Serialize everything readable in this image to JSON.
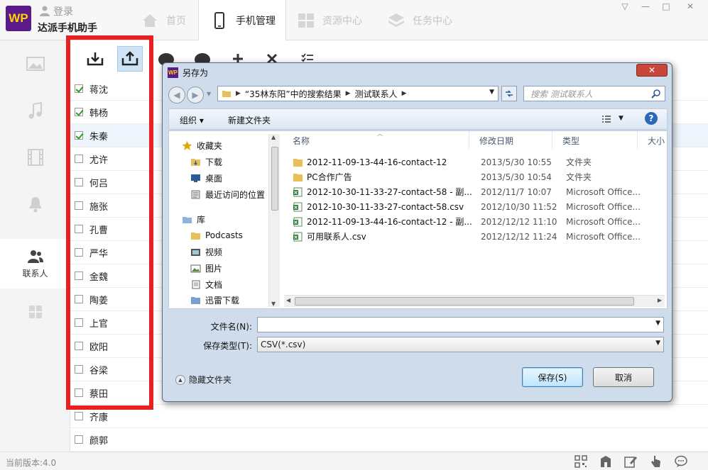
{
  "app": {
    "logo_text": "WP",
    "login_label": "登录",
    "title": "达派手机助手",
    "tabs": [
      {
        "label": "首页",
        "icon": "home-icon"
      },
      {
        "label": "手机管理",
        "icon": "phone-icon"
      },
      {
        "label": "资源中心",
        "icon": "grid-icon"
      },
      {
        "label": "任务中心",
        "icon": "layers-icon"
      }
    ],
    "window_controls": [
      "▽",
      "—",
      "□",
      "✕"
    ]
  },
  "left_nav": {
    "items": [
      {
        "icon": "photo-icon",
        "label": ""
      },
      {
        "icon": "music-icon",
        "label": ""
      },
      {
        "icon": "video-icon",
        "label": ""
      },
      {
        "icon": "bell-icon",
        "label": ""
      },
      {
        "icon": "contacts-icon",
        "label": "联系人"
      },
      {
        "icon": "apps-icon",
        "label": ""
      }
    ]
  },
  "toolbar": {
    "icons": [
      "import-icon",
      "export-icon",
      "download-icon",
      "upload-icon",
      "add-icon",
      "delete-icon",
      "check-list-icon"
    ]
  },
  "contacts": [
    {
      "name": "蒋沈",
      "checked": true
    },
    {
      "name": "韩杨",
      "checked": true
    },
    {
      "name": "朱秦",
      "checked": true
    },
    {
      "name": "尤许",
      "checked": false
    },
    {
      "name": "何吕",
      "checked": false
    },
    {
      "name": "施张",
      "checked": false
    },
    {
      "name": "孔曹",
      "checked": false
    },
    {
      "name": "严华",
      "checked": false
    },
    {
      "name": "金魏",
      "checked": false
    },
    {
      "name": "陶姜",
      "checked": false
    },
    {
      "name": "上官",
      "checked": false
    },
    {
      "name": "欧阳",
      "checked": false
    },
    {
      "name": "谷梁",
      "checked": false
    },
    {
      "name": "蔡田",
      "checked": false
    },
    {
      "name": "齐康",
      "checked": false
    },
    {
      "name": "颜郭",
      "checked": false
    }
  ],
  "status_bar": {
    "version": "当前版本:4.0",
    "icons": [
      "qrcode-icon",
      "store-icon",
      "edit-icon",
      "hand-icon",
      "chat-icon"
    ]
  },
  "dialog": {
    "title": "另存为",
    "close_label": "✕",
    "address": {
      "segment1": "“35林东阳”中的搜索结果",
      "segment2": "测试联系人"
    },
    "search_placeholder": "搜索 测试联系人",
    "commands": {
      "organize": "组织 ▾",
      "new_folder": "新建文件夹"
    },
    "tree": {
      "favorites_header": "收藏夹",
      "favorites": [
        "下载",
        "桌面",
        "最近访问的位置"
      ],
      "library_header": "库",
      "libraries": [
        "Podcasts",
        "视频",
        "图片",
        "文档",
        "迅雷下载"
      ]
    },
    "columns": [
      "名称",
      "修改日期",
      "类型",
      "大小"
    ],
    "files": [
      {
        "name": "2012-11-09-13-44-16-contact-12",
        "date": "2013/5/30 10:55",
        "type": "文件夹",
        "kind": "folder"
      },
      {
        "name": "PC合作广告",
        "date": "2013/5/30 10:54",
        "type": "文件夹",
        "kind": "folder"
      },
      {
        "name": "2012-10-30-11-33-27-contact-58 - 副...",
        "date": "2012/11/7 10:07",
        "type": "Microsoft Office...",
        "kind": "csv"
      },
      {
        "name": "2012-10-30-11-33-27-contact-58.csv",
        "date": "2012/10/30 11:52",
        "type": "Microsoft Office...",
        "kind": "csv"
      },
      {
        "name": "2012-11-09-13-44-16-contact-12 - 副...",
        "date": "2012/12/12 11:10",
        "type": "Microsoft Office...",
        "kind": "csv"
      },
      {
        "name": "可用联系人.csv",
        "date": "2012/12/12 11:24",
        "type": "Microsoft Office...",
        "kind": "csv"
      }
    ],
    "filename_label": "文件名(N):",
    "filename_value": "",
    "filetype_label": "保存类型(T):",
    "filetype_value": "CSV(*.csv)",
    "hide_folders_label": "隐藏文件夹",
    "save_label": "保存(S)",
    "cancel_label": "取消"
  },
  "colors": {
    "highlight_frame": "#e82020",
    "brand": "#5a1a8a"
  }
}
